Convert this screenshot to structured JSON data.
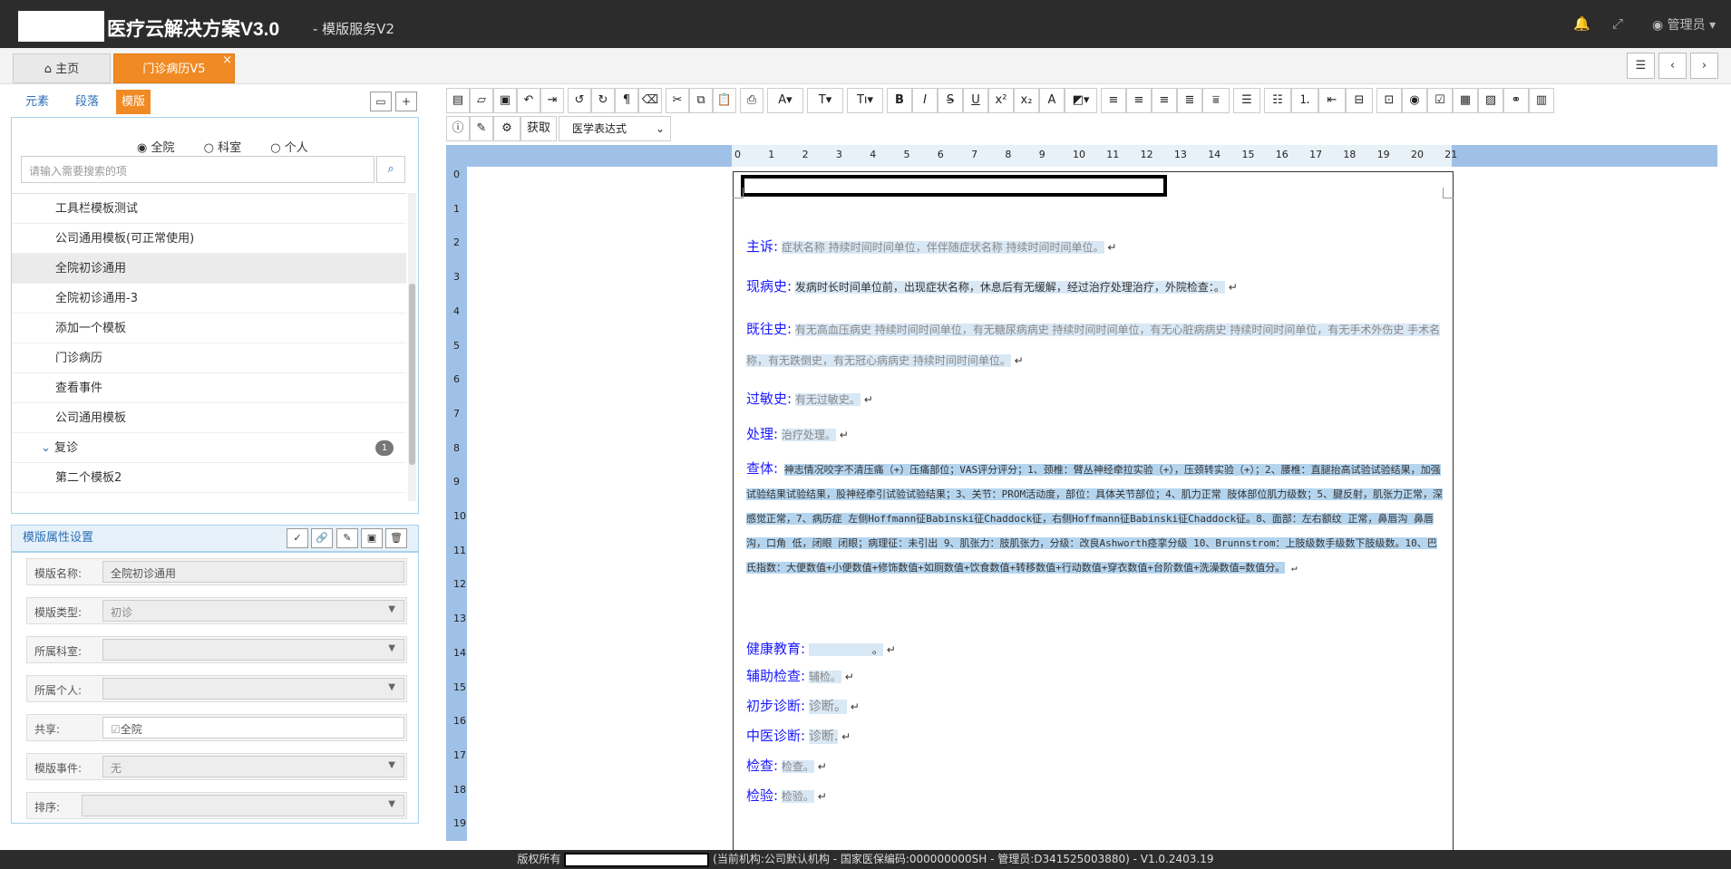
{
  "header": {
    "title": "医疗云解决方案V3.0",
    "subtitle": "- 模版服务V2",
    "admin": "管理员",
    "icons": [
      "bell-icon",
      "expand-icon",
      "user-icon"
    ]
  },
  "tabs": [
    {
      "label": "主页",
      "icon": "home-icon"
    },
    {
      "label": "门诊病历V5",
      "active": true
    }
  ],
  "left": {
    "tabs": [
      "元素",
      "段落",
      "模版"
    ],
    "active_tab": "模版",
    "scope": {
      "options": [
        "全院",
        "科室",
        "个人"
      ],
      "selected": "全院"
    },
    "search_placeholder": "请输入需要搜索的项",
    "templates": [
      {
        "label": "工具栏模板测试"
      },
      {
        "label": "公司通用模板(可正常使用)"
      },
      {
        "label": "全院初诊通用",
        "selected": true
      },
      {
        "label": "全院初诊通用-3"
      },
      {
        "label": "添加一个模板"
      },
      {
        "label": "门诊病历"
      },
      {
        "label": "查看事件"
      },
      {
        "label": "公司通用模板"
      },
      {
        "label": "复诊",
        "group": true,
        "badge": "1"
      },
      {
        "label": "第二个模板2"
      }
    ],
    "props_title": "模版属性设置",
    "props": {
      "name_label": "模版名称:",
      "name_value": "全院初诊通用",
      "type_label": "模版类型:",
      "type_value": "初诊",
      "dept_label": "所属科室:",
      "dept_value": "",
      "person_label": "所属个人:",
      "person_value": "",
      "share_label": "共享:",
      "share_value": "全院",
      "event_label": "模版事件:",
      "event_value": "无",
      "order_label": "排序:",
      "order_value": ""
    }
  },
  "toolbar": {
    "fetch_label": "获取",
    "expr_select": "医学表达式"
  },
  "ruler": {
    "h": [
      "0",
      "1",
      "2",
      "3",
      "4",
      "5",
      "6",
      "7",
      "8",
      "9",
      "10",
      "11",
      "12",
      "13",
      "14",
      "15",
      "16",
      "17",
      "18",
      "19",
      "20",
      "21"
    ],
    "v": [
      "0",
      "1",
      "2",
      "3",
      "4",
      "5",
      "6",
      "7",
      "8",
      "9",
      "10",
      "11",
      "12",
      "13",
      "14",
      "15",
      "16",
      "17",
      "18",
      "19"
    ]
  },
  "document": {
    "zhusu_h": "主诉:",
    "zhusu": "症状名称 持续时间时间单位，伴伴随症状名称 持续时间时间单位。",
    "xianbing_h": "现病史:",
    "xianbing": "发病时长时间单位前，出现症状名称，休息后有无缓解，经过治疗处理治疗，外院检查：。",
    "jiwang_h": "既往史:",
    "jiwang": "有无高血压病史 持续时间时间单位，有无糖尿病病史 持续时间时间单位，有无心脏病病史 持续时间时间单位，有无手术外伤史 手术名称，有无跌倒史，有无冠心病病史 持续时间时间单位。",
    "guomin_h": "过敏史:",
    "guomin": "有无过敏史。",
    "chuli_h": "处理:",
    "chuli": "治疗处理。",
    "chati_h": "查体:",
    "chati": "神志情况咬字不清压痛（+）压痛部位；VAS评分评分；1、颈椎：臂丛神经牵拉实验（+），压颈转实验（+）；2、腰椎：直腿抬高试验试验结果，加强试验结果试验结果，股神经牵引试验试验结果；3、关节：PROM活动度，部位：具体关节部位；4、肌力正常 肢体部位肌力级数；5、腱反射，肌张力正常，深感觉正常，7、病历症 左侧Hoffmann征Babinski征Chaddock征，右侧Hoffmann征Babinski征Chaddock征。8、面部：左右额纹 正常，鼻唇沟 鼻唇沟，口角 低，闭眼 闭眼；病理征：未引出 9、肌张力：肢肌张力，分级：改良Ashworth痉挛分级 10、Brunnstrom：上肢级数手级数下肢级数。10、巴氏指数：大便数值+小便数值+修饰数值+如厕数值+饮食数值+转移数值+行动数值+穿衣数值+台阶数值+洗澡数值=数值分。",
    "jiankang_h": "健康教育:",
    "jiankang": "。",
    "fuzhu_h": "辅助检查:",
    "fuzhu": "辅检。",
    "chubu_h": "初步诊断:",
    "chubu": "诊断。",
    "zhongyi_h": "中医诊断:",
    "zhongyi": "诊断.",
    "jiancha_h": "检查:",
    "jiancha": "检查。",
    "jianyan_h": "检验:",
    "jianyan": "检验。"
  },
  "footer": {
    "prefix": "版权所有",
    "info": "(当前机构:公司默认机构 - 国家医保编码:000000000SH - 管理员:D341525003880)  -  V1.0.2403.19"
  },
  "colors": {
    "accent": "#f08a24",
    "topbar": "#2c2c2c",
    "heading": "#1a1aff",
    "ruler": "#9fc1e7"
  }
}
